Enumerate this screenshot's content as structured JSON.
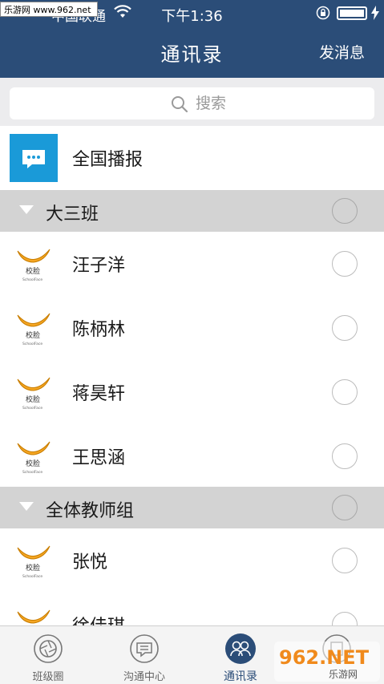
{
  "status_bar": {
    "carrier": "中国联通",
    "time": "下午1:36"
  },
  "watermark": "乐游网 www.962.net",
  "nav": {
    "title": "通讯录",
    "action": "发消息"
  },
  "search": {
    "placeholder": "搜索",
    "value": ""
  },
  "broadcast": {
    "label": "全国播报"
  },
  "logo_text": {
    "cn": "校脸",
    "en": "SchoolFace"
  },
  "groups": [
    {
      "name": "大三班",
      "members": [
        "汪子洋",
        "陈柄林",
        "蒋昊轩",
        "王思涵"
      ]
    },
    {
      "name": "全体教师组",
      "members": [
        "张悦",
        "徐佳琪"
      ]
    }
  ],
  "tabs": [
    {
      "label": "班级圈",
      "active": false
    },
    {
      "label": "沟通中心",
      "active": false
    },
    {
      "label": "通讯录",
      "active": true
    },
    {
      "label": "",
      "active": false
    }
  ],
  "colors": {
    "header": "#2b4d78",
    "broadcast_icon": "#1a9ad8",
    "logo_orange": "#f5a623",
    "group_header_bg": "#d3d3d3"
  },
  "icons": {
    "wifi": "wifi-icon",
    "battery": "battery-icon",
    "search": "search-icon",
    "broadcast": "chat-bubble-icon",
    "tab_class_circle": "camera-lens-icon",
    "tab_chat": "chat-icon",
    "tab_contacts": "people-icon"
  },
  "overlay_badge": {
    "text": "962.NET",
    "subtext": "乐游网"
  }
}
